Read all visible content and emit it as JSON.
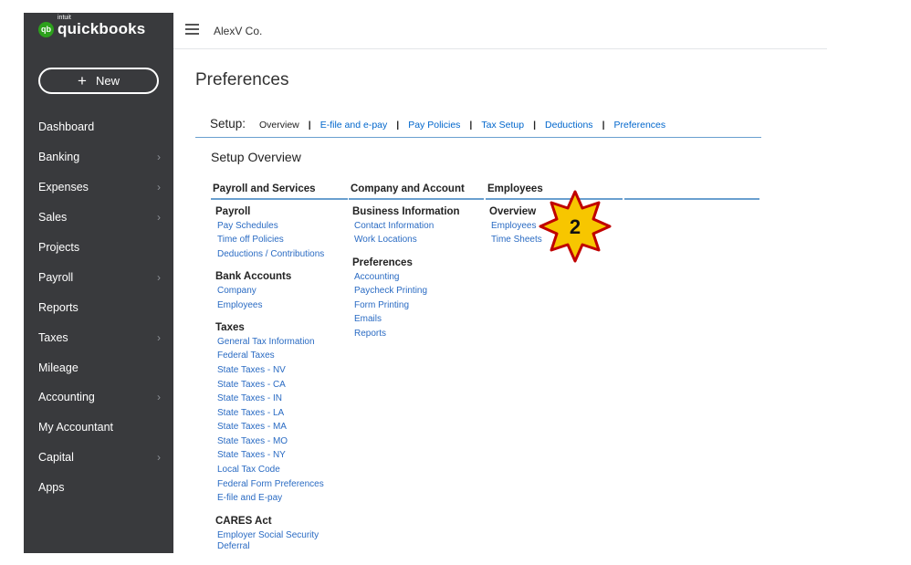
{
  "app": {
    "logo_intuit": "intuit",
    "logo_name": "quickbooks",
    "logo_mark": "qb"
  },
  "sidebar": {
    "new_label": "New",
    "items": [
      {
        "label": "Dashboard",
        "has_submenu": false
      },
      {
        "label": "Banking",
        "has_submenu": true
      },
      {
        "label": "Expenses",
        "has_submenu": true
      },
      {
        "label": "Sales",
        "has_submenu": true
      },
      {
        "label": "Projects",
        "has_submenu": false
      },
      {
        "label": "Payroll",
        "has_submenu": true
      },
      {
        "label": "Reports",
        "has_submenu": false
      },
      {
        "label": "Taxes",
        "has_submenu": true
      },
      {
        "label": "Mileage",
        "has_submenu": false
      },
      {
        "label": "Accounting",
        "has_submenu": true
      },
      {
        "label": "My Accountant",
        "has_submenu": false
      },
      {
        "label": "Capital",
        "has_submenu": true
      },
      {
        "label": "Apps",
        "has_submenu": false
      }
    ]
  },
  "header": {
    "company": "AlexV Co."
  },
  "page": {
    "title": "Preferences"
  },
  "setup": {
    "label": "Setup:",
    "tabs": [
      "Overview",
      "E-file and e-pay",
      "Pay Policies",
      "Tax Setup",
      "Deductions",
      "Preferences"
    ],
    "active_tab": "Overview"
  },
  "overview": {
    "title": "Setup Overview",
    "columns": [
      {
        "heading": "Payroll and Services",
        "groups": [
          {
            "title": "Payroll",
            "links": [
              "Pay Schedules",
              "Time off Policies",
              "Deductions / Contributions"
            ]
          },
          {
            "title": "Bank Accounts",
            "links": [
              "Company",
              "Employees"
            ]
          },
          {
            "title": "Taxes",
            "links": [
              "General Tax Information",
              "Federal Taxes",
              "State Taxes - NV",
              "State Taxes - CA",
              "State Taxes - IN",
              "State Taxes - LA",
              "State Taxes - MA",
              "State Taxes - MO",
              "State Taxes - NY",
              "Local Tax Code",
              "Federal Form Preferences",
              "E-file and E-pay"
            ]
          },
          {
            "title": "CARES Act",
            "links": [
              "Employer Social Security",
              "Deferral"
            ]
          }
        ]
      },
      {
        "heading": "Company and Account",
        "groups": [
          {
            "title": "Business Information",
            "links": [
              "Contact Information",
              "Work Locations"
            ]
          },
          {
            "title": "Preferences",
            "links": [
              "Accounting",
              "Paycheck Printing",
              "Form Printing",
              "Emails",
              "Reports"
            ]
          }
        ]
      },
      {
        "heading": "Employees",
        "groups": [
          {
            "title": "Overview",
            "links": [
              "Employees",
              "Time Sheets"
            ]
          }
        ]
      }
    ]
  },
  "annotation": {
    "step_number": "2",
    "fill_color": "#f7c600",
    "border_color": "#c00000"
  },
  "colors": {
    "sidebar_bg": "#393a3d",
    "link": "#2a6bc3",
    "accent_line": "#6a9fcf",
    "brand_green": "#2ca01c"
  }
}
